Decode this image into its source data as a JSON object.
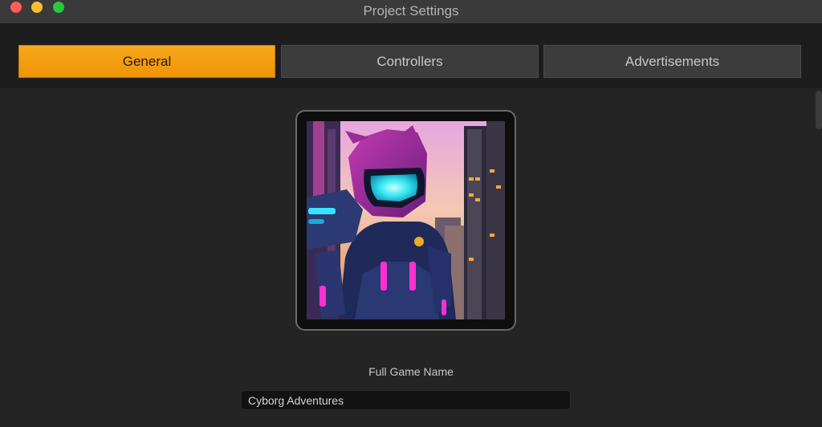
{
  "window": {
    "title": "Project Settings"
  },
  "tabs": [
    {
      "label": "General",
      "active": true
    },
    {
      "label": "Controllers",
      "active": false
    },
    {
      "label": "Advertisements",
      "active": false
    }
  ],
  "general": {
    "full_name_label": "Full Game Name",
    "full_name_value": "Cyborg Adventures",
    "icon_image": "cyborg-robot-character-icon"
  },
  "colors": {
    "accent": "#f29b0f",
    "background": "#242424",
    "tab_inactive": "#3c3c3c"
  }
}
